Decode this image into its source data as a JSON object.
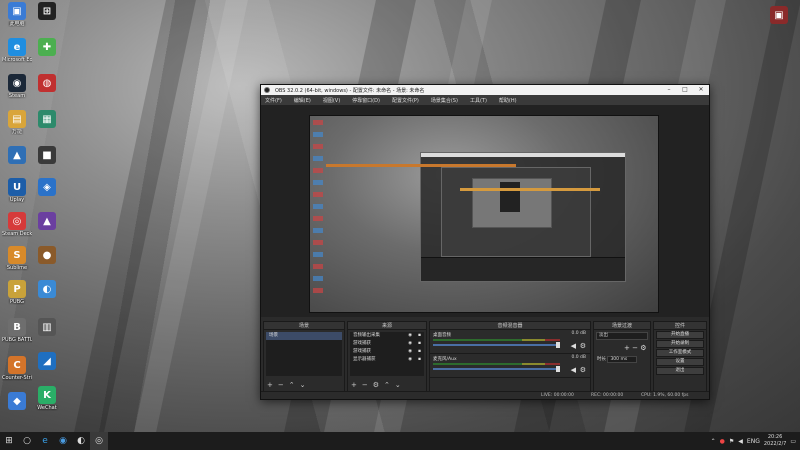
{
  "desktop": {
    "icons": [
      {
        "label": "此电脑",
        "icon": "computer-icon",
        "color": "#3a7bd5"
      },
      {
        "label": "Microsoft Edge",
        "icon": "edge-icon",
        "color": "#1f8ee0"
      },
      {
        "label": "Steam",
        "icon": "steam-icon",
        "color": "#1b2838"
      },
      {
        "label": "万能",
        "icon": "app-icon",
        "color": "#d9a53a"
      },
      {
        "label": "",
        "icon": "app-icon",
        "color": "#2f6fb5"
      },
      {
        "label": "Uplay",
        "icon": "uplay-icon",
        "color": "#1c5da8"
      },
      {
        "label": "Steam Deck",
        "icon": "app-icon",
        "color": "#d63a3a"
      },
      {
        "label": "Sublime",
        "icon": "app-icon",
        "color": "#d88a2a"
      },
      {
        "label": "PUBG",
        "icon": "app-icon",
        "color": "#c9a23a"
      },
      {
        "label": "PUBG BATTLEGROUNDS",
        "icon": "app-icon",
        "color": "#6e6e6e"
      },
      {
        "label": "Counter-Strike",
        "icon": "app-icon",
        "color": "#d4742a"
      },
      {
        "label": "",
        "icon": "app-icon",
        "color": "#3a7bd5"
      },
      {
        "label": "WeChat",
        "icon": "wechat-icon",
        "color": "#2aae67"
      },
      {
        "label": "",
        "icon": "app-icon",
        "color": "#222"
      },
      {
        "label": "",
        "icon": "app-icon",
        "color": "#4caf50"
      },
      {
        "label": "",
        "icon": "app-icon",
        "color": "#c03030"
      },
      {
        "label": "",
        "icon": "app-icon",
        "color": "#2d8a6b"
      },
      {
        "label": "",
        "icon": "app-icon",
        "color": "#3a3a3a"
      },
      {
        "label": "",
        "icon": "app-icon",
        "color": "#2a72c9"
      },
      {
        "label": "",
        "icon": "app-icon",
        "color": "#6b3fa0"
      },
      {
        "label": "",
        "icon": "app-icon",
        "color": "#8a5a2a"
      },
      {
        "label": "",
        "icon": "app-icon",
        "color": "#3a8ad5"
      },
      {
        "label": "",
        "icon": "app-icon",
        "color": "#555"
      },
      {
        "label": "",
        "icon": "app-icon",
        "color": "#1f6fc0"
      },
      {
        "label": "",
        "icon": "app-icon",
        "color": "#444"
      }
    ]
  },
  "obs": {
    "title": "OBS 32.0.2 (64-bit, windows) - 配置文件: 未命名 - 场景: 未命名",
    "menu": [
      "文件(F)",
      "编辑(E)",
      "视图(V)",
      "停靠窗口(D)",
      "配置文件(P)",
      "场景集合(S)",
      "工具(T)",
      "帮助(H)"
    ],
    "docks": {
      "scenes": {
        "title": "场景",
        "items": [
          "场景"
        ]
      },
      "sources": {
        "title": "来源",
        "items": [
          "音频输出采集",
          "游戏捕获",
          "游戏捕获",
          "显示器捕获"
        ]
      },
      "mixer": {
        "title": "音频混音器",
        "channels": [
          {
            "name": "桌面音频",
            "db": "0.0 dB"
          },
          {
            "name": "麦克风/Aux",
            "db": "0.0 dB"
          }
        ]
      },
      "transitions": {
        "title": "场景过渡",
        "type": "淡出",
        "duration_label": "时长",
        "duration": "300 ms"
      },
      "controls": {
        "title": "控件",
        "buttons": [
          "开始直播",
          "开始录制",
          "工作室模式",
          "设置",
          "退出"
        ]
      }
    },
    "status": {
      "live": "LIVE: 00:00:00",
      "rec": "REC: 00:00:00",
      "cpu": "CPU: 1.9%, 60.00 fps"
    }
  },
  "taskbar": {
    "time": "20:26",
    "date": "2022/2/7",
    "lang": "ENG",
    "apps": [
      "windows-logo-icon",
      "search-icon",
      "edge-icon",
      "chrome-icon",
      "steam-icon",
      "obs-icon"
    ]
  }
}
